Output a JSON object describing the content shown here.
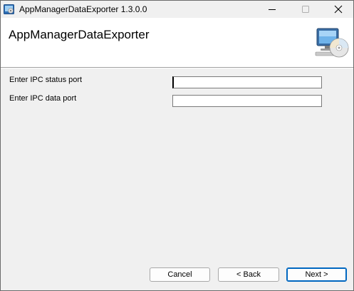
{
  "window": {
    "title": "AppManagerDataExporter 1.3.0.0",
    "icon": "installer-icon",
    "controls": {
      "minimize": "minimize-icon",
      "maximize": "maximize-icon",
      "close": "close-icon"
    }
  },
  "banner": {
    "title": "AppManagerDataExporter",
    "icon": "computer-cd-icon"
  },
  "form": {
    "status_port_label": "Enter IPC status port",
    "status_port_value": "",
    "data_port_label": "Enter IPC data port",
    "data_port_value": ""
  },
  "buttons": {
    "cancel": "Cancel",
    "back": "< Back",
    "next": "Next >"
  },
  "colors": {
    "window_bg": "#f0f0f0",
    "banner_bg": "#ffffff",
    "default_button_border": "#0067c0"
  }
}
